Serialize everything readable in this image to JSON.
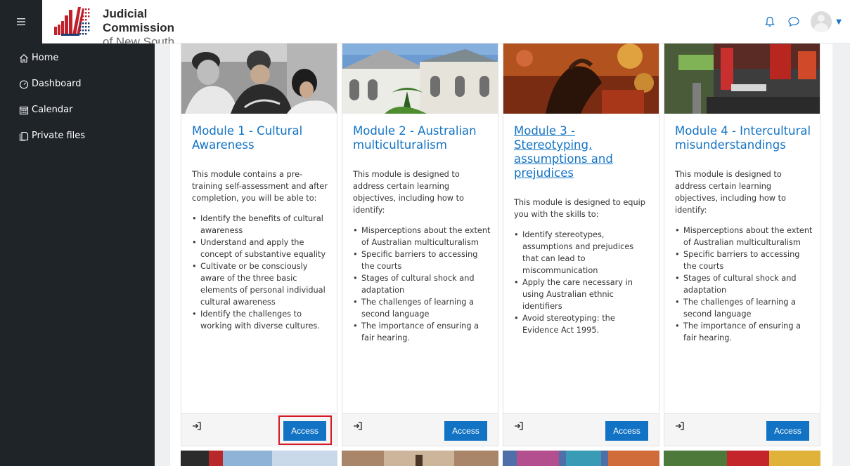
{
  "header": {
    "menu_icon": "hamburger-icon",
    "brand_title": "Judicial Commission",
    "brand_subtitle": "of New South Wales",
    "icons": [
      "bell-icon",
      "chat-icon",
      "avatar",
      "chevron-down-icon"
    ]
  },
  "sidebar": {
    "items": [
      {
        "label": "Home",
        "icon": "home-icon"
      },
      {
        "label": "Dashboard",
        "icon": "dashboard-icon"
      },
      {
        "label": "Calendar",
        "icon": "calendar-icon"
      },
      {
        "label": "Private files",
        "icon": "file-icon"
      }
    ]
  },
  "cards": [
    {
      "title": "Module 1 - Cultural Awareness",
      "description": "This module contains a pre-training self-assessment and after completion, you will be able to:",
      "bullets": [
        "Identify the benefits of cultural awareness",
        "Understand and apply the concept of substantive equality",
        "Cultivate or be consciously aware of the three basic elements of personal individual cultural awareness",
        "Identify the challenges to working with diverse cultures."
      ],
      "button": "Access"
    },
    {
      "title": "Module 2 - Australian multiculturalism",
      "description": "This module is designed to address certain learning objectives, including how to identify:",
      "bullets": [
        "Misperceptions about the extent of Australian multiculturalism",
        "Specific barriers to accessing the courts",
        "Stages of cultural shock and adaptation",
        "The challenges of learning a second language",
        "The importance of ensuring a fair hearing."
      ],
      "button": "Access"
    },
    {
      "title": "Module 3 - Stereotyping, assumptions and prejudices",
      "description": "This module is designed to equip you with the skills to:",
      "bullets": [
        "Identify stereotypes, assumptions and prejudices that can lead to miscommunication",
        "Apply the care necessary in using Australian ethnic identifiers",
        "Avoid stereotyping: the Evidence Act 1995."
      ],
      "button": "Access"
    },
    {
      "title": "Module 4 - Intercultural misunderstandings",
      "description": "This module is designed to address certain learning objectives, including how to identify:",
      "bullets": [
        "Misperceptions about the extent of Australian multiculturalism",
        "Specific barriers to accessing the courts",
        "Stages of cultural shock and adaptation",
        "The challenges of learning a second language",
        "The importance of ensuring a fair hearing."
      ],
      "button": "Access"
    }
  ],
  "colors": {
    "sidebar_bg": "#1f2429",
    "link_blue": "#1273c4",
    "highlight_red": "#d51a26",
    "brand_red": "#c0212b"
  }
}
